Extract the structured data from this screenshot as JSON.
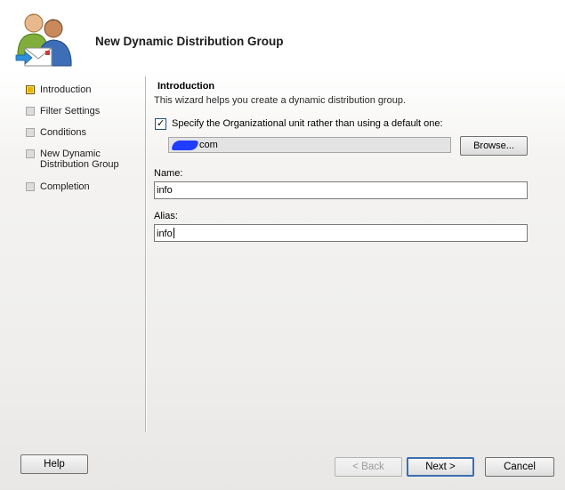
{
  "window": {
    "title": "New Dynamic Distribution Group"
  },
  "nav": {
    "items": [
      {
        "label": "Introduction",
        "active": true
      },
      {
        "label": "Filter Settings",
        "active": false
      },
      {
        "label": "Conditions",
        "active": false
      },
      {
        "label": "New Dynamic Distribution Group",
        "active": false
      },
      {
        "label": "Completion",
        "active": false
      }
    ]
  },
  "content": {
    "section_title": "Introduction",
    "description": "This wizard helps you create a dynamic distribution group.",
    "ou_checkbox": {
      "label": "Specify the Organizational unit rather than using a default one:",
      "checked": true
    },
    "ou_field": {
      "value": "com"
    },
    "browse_label": "Browse...",
    "name": {
      "label": "Name:",
      "value": "info"
    },
    "alias": {
      "label": "Alias:",
      "value": "info"
    }
  },
  "footer": {
    "help_label": "Help",
    "back_label": "< Back",
    "next_label": "Next >",
    "cancel_label": "Cancel"
  },
  "icons": {
    "header": "users-mail-icon",
    "check": "✓"
  },
  "colors": {
    "active_bullet": "#e8b400",
    "inactive_bullet": "#dcdcdc",
    "redaction": "#1f3cff"
  }
}
